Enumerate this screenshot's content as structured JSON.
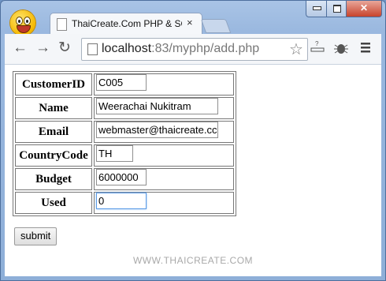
{
  "browser": {
    "tab_title": "ThaiCreate.Com PHP & SQ",
    "tab_close": "×",
    "url_host": "localhost",
    "url_rest": ":83/myphp/add.php",
    "window_min": "▭",
    "window_max": "□",
    "window_close": "✕"
  },
  "form": {
    "rows": [
      {
        "label": "CustomerID",
        "value": "C005"
      },
      {
        "label": "Name",
        "value": "Weerachai Nukitram"
      },
      {
        "label": "Email",
        "value": "webmaster@thaicreate.cc"
      },
      {
        "label": "CountryCode",
        "value": "TH"
      },
      {
        "label": "Budget",
        "value": "6000000"
      },
      {
        "label": "Used",
        "value": "0"
      }
    ],
    "submit_label": "submit"
  },
  "watermark": "WWW.THAICREATE.COM",
  "icons": {
    "back": "back-arrow-icon",
    "forward": "forward-arrow-icon",
    "reload": "reload-icon",
    "star": "bookmark-star-icon",
    "menu": "menu-icon"
  }
}
